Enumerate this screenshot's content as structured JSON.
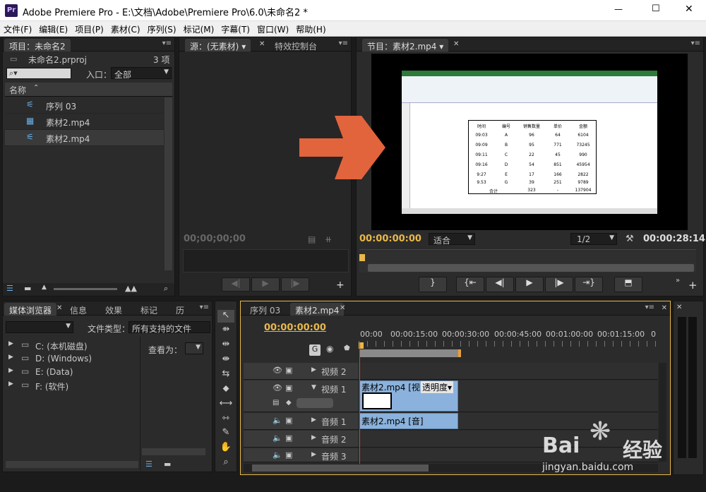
{
  "titlebar": {
    "title": "Adobe Premiere Pro - E:\\文档\\Adobe\\Premiere Pro\\6.0\\未命名2 *",
    "logo": "Pr",
    "minimize": "—",
    "maximize": "☐",
    "close": "✕"
  },
  "menu": [
    "文件(F)",
    "编辑(E)",
    "项目(P)",
    "素材(C)",
    "序列(S)",
    "标记(M)",
    "字幕(T)",
    "窗口(W)",
    "帮助(H)"
  ],
  "project": {
    "tab": "项目：未命名2",
    "file": "未命名2.prproj",
    "count": "3 项",
    "entry_label": "入口：",
    "entry_value": "全部",
    "col_name": "名称",
    "items": [
      {
        "label": "序列 03"
      },
      {
        "label": "素材2.mp4"
      },
      {
        "label": "素材2.mp4"
      }
    ]
  },
  "source": {
    "tab": "源：(无素材)",
    "tab2": "特效控制台",
    "timecode": "00;00;00;00"
  },
  "program": {
    "tab": "节目：素材2.mp4",
    "timecode_left": "00:00:00:00",
    "fit": "适合",
    "ratio": "1/2",
    "timecode_right": "00:00:28:14"
  },
  "media": {
    "tabs": [
      "媒体浏览器",
      "信息",
      "效果",
      "标记",
      "历"
    ],
    "filetype_label": "文件类型：",
    "filetype_value": "所有支持的文件",
    "view_label": "查看为：",
    "drives": [
      "C: (本机磁盘)",
      "D: (Windows)",
      "E: (Data)",
      "F: (软件)"
    ]
  },
  "timeline": {
    "tabs": [
      "序列 03",
      "素材2.mp4"
    ],
    "timecode": "00:00:00:00",
    "ruler": [
      "00:00",
      "00:00:15:00",
      "00:00:30:00",
      "00:00:45:00",
      "00:01:00:00",
      "00:01:15:00",
      "0"
    ],
    "tracks": [
      {
        "name": "视频 2"
      },
      {
        "name": "视频 1"
      },
      {
        "name": "音频 1"
      },
      {
        "name": "音频 2"
      },
      {
        "name": "音频 3"
      }
    ],
    "video_clip": "素材2.mp4 [视]",
    "video_clip_fx": "透明度",
    "audio_clip": "素材2.mp4 [音]"
  },
  "sheet": {
    "headers": [
      "时间",
      "编号",
      "销售数量",
      "单价",
      "金额"
    ],
    "rows": [
      [
        "09:03",
        "A",
        "96",
        "64",
        "6104"
      ],
      [
        "09:09",
        "B",
        "95",
        "771",
        "73245"
      ],
      [
        "09:11",
        "C",
        "22",
        "45",
        "990"
      ],
      [
        "09:16",
        "D",
        "54",
        "851",
        "45954"
      ],
      [
        "9:27",
        "E",
        "17",
        "166",
        "2822"
      ],
      [
        "9.53",
        "G",
        "39",
        "251",
        "9789"
      ]
    ],
    "total": [
      "合计",
      "",
      "323",
      "-",
      "137904"
    ]
  },
  "watermark": {
    "site": "jingyan.baidu.com",
    "brand": "Bai",
    "brand2": "经验"
  },
  "colors": {
    "accent": "#e8b84a",
    "arrow": "#e2643c",
    "clip": "#8ab2dc"
  }
}
